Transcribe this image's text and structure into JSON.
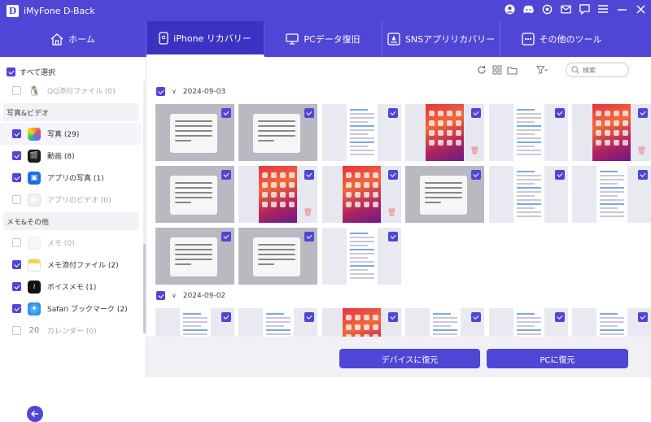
{
  "app": {
    "title": "iMyFone D-Back",
    "logo_letter": "D"
  },
  "titlebar_icons": [
    "user-icon",
    "discord-icon",
    "settings-icon",
    "mail-icon",
    "chat-icon",
    "menu-icon",
    "minimize-icon",
    "close-icon"
  ],
  "nav": {
    "tabs": [
      {
        "label": "ホーム",
        "icon": "home-icon",
        "active": false
      },
      {
        "label": "iPhone リカバリー",
        "icon": "phone-icon",
        "active": true
      },
      {
        "label": "PCデータ復旧",
        "icon": "monitor-icon",
        "active": false
      },
      {
        "label": "SNSアプリリカバリー",
        "icon": "apps-icon",
        "active": false
      },
      {
        "label": "その他のツール",
        "icon": "more-icon",
        "active": false
      }
    ]
  },
  "sidebar": {
    "select_all": "すべて選択",
    "items": [
      {
        "type": "item",
        "label": "QQ添付ファイル (0)",
        "checked": false,
        "dim": true,
        "icon": "qq-icon"
      },
      {
        "type": "group",
        "label": "写真&ビデオ"
      },
      {
        "type": "item",
        "label": "写真 (29)",
        "checked": true,
        "dim": false,
        "icon": "photos-icon",
        "selected": true
      },
      {
        "type": "item",
        "label": "動画 (8)",
        "checked": true,
        "dim": false,
        "icon": "video-icon"
      },
      {
        "type": "item",
        "label": "アプリの写真 (1)",
        "checked": true,
        "dim": false,
        "icon": "app-photo-icon"
      },
      {
        "type": "item",
        "label": "アプリのビデオ (0)",
        "checked": false,
        "dim": true,
        "icon": "app-video-icon"
      },
      {
        "type": "group",
        "label": "メモ&その他"
      },
      {
        "type": "item",
        "label": "メモ (0)",
        "checked": false,
        "dim": true,
        "icon": "notes-icon"
      },
      {
        "type": "item",
        "label": "メモ添付ファイル (2)",
        "checked": true,
        "dim": false,
        "icon": "notes-attach-icon"
      },
      {
        "type": "item",
        "label": "ボイスメモ (1)",
        "checked": true,
        "dim": false,
        "icon": "voice-memo-icon"
      },
      {
        "type": "item",
        "label": "Safari ブックマーク (2)",
        "checked": true,
        "dim": false,
        "icon": "safari-icon"
      },
      {
        "type": "item",
        "label": "カレンダー (0)",
        "checked": false,
        "dim": true,
        "icon": "calendar-icon",
        "badge": "20"
      }
    ]
  },
  "toolbar": {
    "icons": [
      "refresh-icon",
      "grid-view-icon",
      "folder-icon",
      "filter-icon"
    ],
    "search_placeholder": "検索"
  },
  "groups": [
    {
      "date": "2024-09-03",
      "checked": true,
      "thumbs": [
        "dialog",
        "dialog",
        "list",
        "phone",
        "list",
        "phone",
        "dialog",
        "phone",
        "phone",
        "dialog",
        "list",
        "list",
        "dialog",
        "dialog",
        "list"
      ]
    },
    {
      "date": "2024-09-02",
      "checked": true,
      "thumbs": [
        "list",
        "list",
        "phone",
        "list",
        "list",
        "list"
      ]
    }
  ],
  "buttons": {
    "restore_device": "デバイスに復元",
    "restore_pc": "PCに復元"
  },
  "colors": {
    "accent": "#4f46d6",
    "nav_active": "#3b32c4"
  }
}
